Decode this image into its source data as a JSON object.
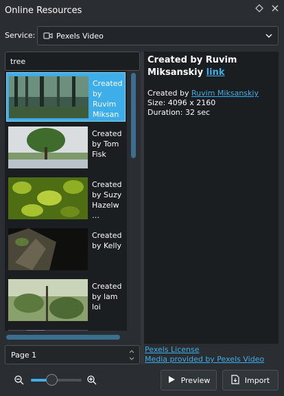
{
  "window": {
    "title": "Online Resources",
    "float_icon": "diamond-icon",
    "close_icon": "close-icon"
  },
  "service": {
    "label": "Service:",
    "selected": "Pexels Video",
    "icon": "video-camera-icon"
  },
  "search": {
    "value": "tree"
  },
  "results": [
    {
      "text": "Created by Ruvim Miksan…",
      "selected": true
    },
    {
      "text": "Created by Tom Fisk",
      "selected": false
    },
    {
      "text": "Created by Suzy Hazelw…",
      "selected": false
    },
    {
      "text": "Created by Kelly",
      "selected": false
    },
    {
      "text": "Created by lam loi",
      "selected": false
    }
  ],
  "pager": {
    "value": "Page 1"
  },
  "details": {
    "title": "Created by Ruvim Miksanskiy",
    "title_link": "link",
    "created_prefix": "Created by ",
    "author": "Ruvim Miksanskiy",
    "size": "Size: 4096 x 2160",
    "duration": "Duration: 32 sec"
  },
  "footer_links": {
    "license": "Pexels License",
    "provider": "Media provided by Pexels Video"
  },
  "zoom": {
    "level": 0.4,
    "out_icon": "zoom-out-icon",
    "in_icon": "zoom-in-icon"
  },
  "buttons": {
    "preview": "Preview",
    "import": "Import"
  },
  "colors": {
    "accent": "#3daee9",
    "background": "#2a2e32"
  }
}
